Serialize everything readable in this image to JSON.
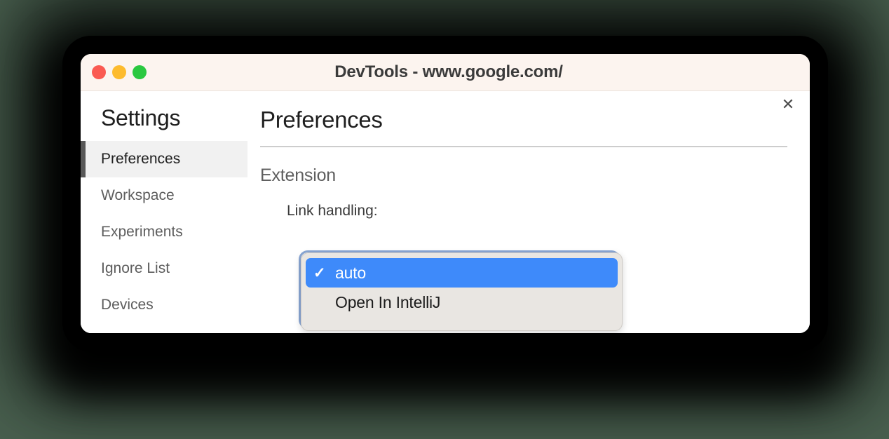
{
  "window": {
    "title": "DevTools - www.google.com/",
    "traffic_lights": [
      {
        "name": "close",
        "color": "#fa5a52"
      },
      {
        "name": "minimize",
        "color": "#fdbb2e"
      },
      {
        "name": "maximize",
        "color": "#2ac840"
      }
    ]
  },
  "sidebar": {
    "title": "Settings",
    "items": [
      {
        "label": "Preferences",
        "selected": true
      },
      {
        "label": "Workspace",
        "selected": false
      },
      {
        "label": "Experiments",
        "selected": false
      },
      {
        "label": "Ignore List",
        "selected": false
      },
      {
        "label": "Devices",
        "selected": false
      }
    ]
  },
  "main": {
    "close_icon": "✕",
    "title": "Preferences",
    "section_title": "Extension",
    "field": {
      "label": "Link handling:",
      "value": "auto"
    }
  },
  "select_popup": {
    "open": true,
    "check_glyph": "✓",
    "highlight_color": "#3e8afa",
    "options": [
      {
        "label": "auto",
        "selected": true
      },
      {
        "label": "Open In IntelliJ",
        "selected": false
      }
    ]
  }
}
